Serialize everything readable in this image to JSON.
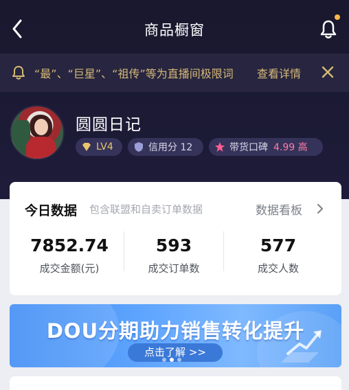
{
  "nav": {
    "title": "商品橱窗"
  },
  "notice": {
    "text": "“最”、“巨星”、“祖传”等为直播间极限词",
    "link": "查看详情"
  },
  "profile": {
    "name": "圆圆日记",
    "level": "LV4",
    "credit": "信用分 12",
    "reputation_label": "带货口碑",
    "reputation_score": "4.99 高"
  },
  "today": {
    "title": "今日数据",
    "subtitle": "包含联盟和自卖订单数据",
    "link": "数据看板",
    "stats": [
      {
        "value": "7852.74",
        "label": "成交金额(元)"
      },
      {
        "value": "593",
        "label": "成交订单数"
      },
      {
        "value": "577",
        "label": "成交人数"
      }
    ]
  },
  "banner": {
    "title": "DOU分期助力销售转化提升",
    "button": "点击了解 >>",
    "active_dot": 1,
    "dot_count": 3
  },
  "colors": {
    "hero_bg": "#1b1a33",
    "notice_text": "#d6b977",
    "badge_bg": "#35335a",
    "banner_blue": "#4a95f6",
    "reputation_pink": "#ff7ca5"
  }
}
